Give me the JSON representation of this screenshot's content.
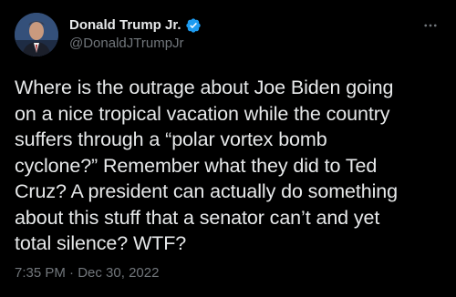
{
  "author": {
    "display_name": "Donald Trump Jr.",
    "handle": "@DonaldJTrumpJr",
    "verified_color": "#1d9bf0"
  },
  "tweet": {
    "text": "Where is the outrage about Joe Biden going\non a nice tropical vacation while the country\nsuffers through a “polar vortex bomb\ncyclone?” Remember what they did to Ted\nCruz? A president can actually do something\nabout this stuff that a senator can’t and yet\ntotal silence? WTF?",
    "time": "7:35 PM",
    "separator": "·",
    "date": "Dec 30, 2022"
  },
  "icons": {
    "verified": "verified-badge-icon",
    "more": "more-options-icon"
  },
  "colors": {
    "background": "#000000",
    "text": "#e7e9ea",
    "secondary": "#71767b"
  }
}
